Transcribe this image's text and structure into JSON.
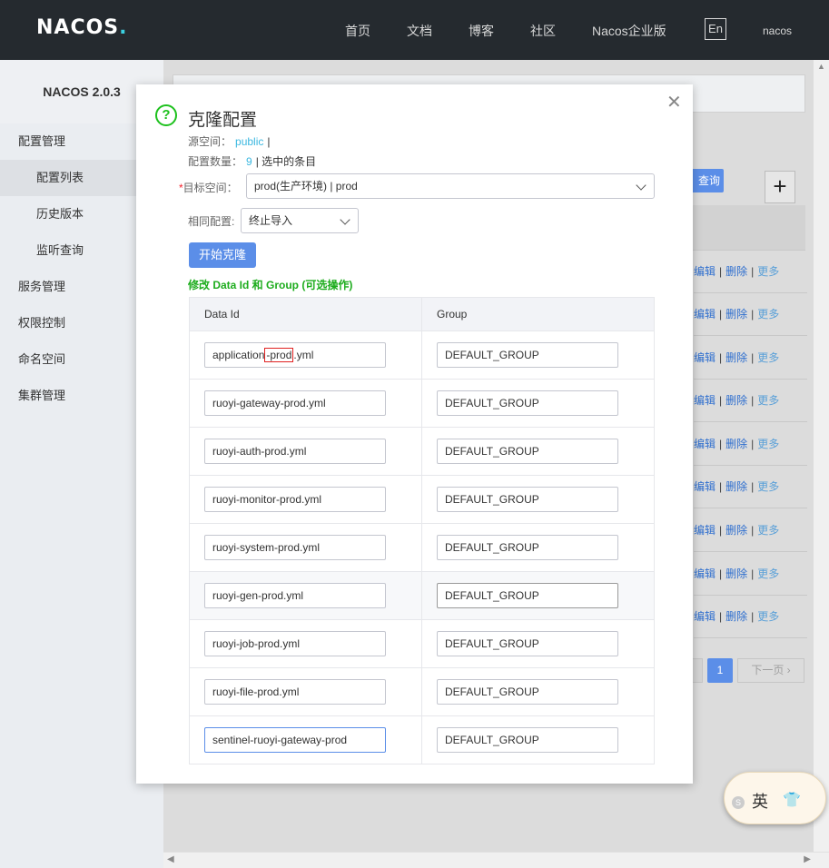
{
  "header": {
    "logo": "NACOS",
    "logo_dot": ".",
    "nav": [
      "首页",
      "文档",
      "博客",
      "社区",
      "Nacos企业版"
    ],
    "lang": "En",
    "user": "nacos"
  },
  "sidebar": {
    "version": "NACOS 2.0.3",
    "items": [
      {
        "label": "配置管理"
      },
      {
        "label": "配置列表"
      },
      {
        "label": "历史版本"
      },
      {
        "label": "监听查询"
      },
      {
        "label": "服务管理"
      },
      {
        "label": "权限控制"
      },
      {
        "label": "命名空间"
      },
      {
        "label": "集群管理"
      }
    ]
  },
  "main": {
    "query_label": "查询",
    "plus": "+",
    "ops": {
      "edit": "编辑",
      "delete": "删除",
      "more": "更多",
      "sep": "|"
    },
    "pager": {
      "current": "1",
      "next": "下一页"
    }
  },
  "dialog": {
    "title": "克隆配置",
    "source_label": "源空间：",
    "source_value": "public",
    "source_sep": "|",
    "count_label": "配置数量：",
    "count_value": "9",
    "count_suffix": "| 选中的条目",
    "target_label": "目标空间：",
    "target_required": "*",
    "target_value": "prod(生产环境) | prod",
    "same_label": "相同配置:",
    "same_value": "终止导入",
    "clone_button": "开始克隆",
    "edit_hint": "修改 Data Id 和 Group (可选操作)",
    "table": {
      "headers": [
        "Data Id",
        "Group"
      ],
      "first_row": {
        "pre": "application",
        "highlight": "-prod",
        "post": ".yml",
        "group": "DEFAULT_GROUP"
      },
      "rows": [
        {
          "data_id": "ruoyi-gateway-prod.yml",
          "group": "DEFAULT_GROUP"
        },
        {
          "data_id": "ruoyi-auth-prod.yml",
          "group": "DEFAULT_GROUP"
        },
        {
          "data_id": "ruoyi-monitor-prod.yml",
          "group": "DEFAULT_GROUP"
        },
        {
          "data_id": "ruoyi-system-prod.yml",
          "group": "DEFAULT_GROUP"
        },
        {
          "data_id": "ruoyi-gen-prod.yml",
          "group": "DEFAULT_GROUP"
        },
        {
          "data_id": "ruoyi-job-prod.yml",
          "group": "DEFAULT_GROUP"
        },
        {
          "data_id": "ruoyi-file-prod.yml",
          "group": "DEFAULT_GROUP"
        },
        {
          "data_id": "sentinel-ruoyi-gateway-prod",
          "group": "DEFAULT_GROUP"
        }
      ]
    }
  },
  "ime": {
    "char": "英"
  },
  "colors": {
    "primary": "#5b8ee8",
    "header_bg": "#252a2f",
    "success": "#1dac1d",
    "link": "#3bb8e0",
    "highlight_box": "#e02020"
  }
}
